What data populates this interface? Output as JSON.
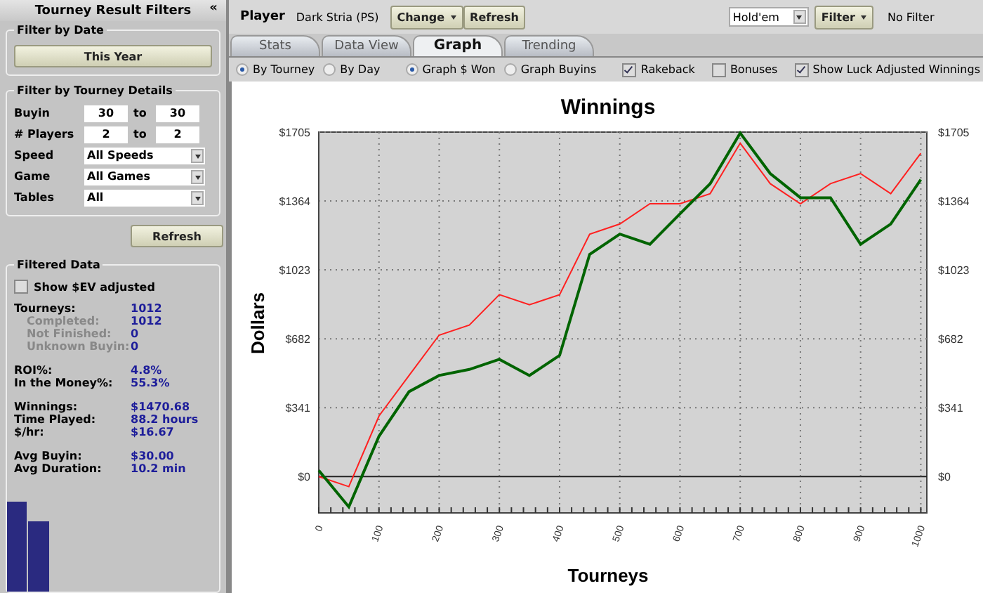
{
  "sidebar": {
    "title": "Tourney Result Filters",
    "collapse": "«",
    "date_filter": {
      "legend": "Filter by Date",
      "button": "This Year"
    },
    "details_filter": {
      "legend": "Filter by Tourney Details",
      "ranges": [
        {
          "label": "Buyin",
          "from": "30",
          "to_label": "to",
          "to": "30"
        },
        {
          "label": "# Players",
          "from": "2",
          "to_label": "to",
          "to": "2"
        }
      ],
      "selects": [
        {
          "label": "Speed",
          "value": "All Speeds"
        },
        {
          "label": "Game",
          "value": "All Games"
        },
        {
          "label": "Tables",
          "value": "All"
        }
      ]
    },
    "refresh": "Refresh",
    "filtered": {
      "legend": "Filtered Data",
      "ev_checkbox": {
        "label": "Show $EV adjusted",
        "checked": false
      },
      "groups": [
        [
          {
            "label": "Tourneys:",
            "value": "1012",
            "kind": "main"
          },
          {
            "label": "Completed:",
            "value": "1012",
            "kind": "sub"
          },
          {
            "label": "Not Finished:",
            "value": "0",
            "kind": "sub"
          },
          {
            "label": "Unknown Buyin:",
            "value": "0",
            "kind": "sub"
          }
        ],
        [
          {
            "label": "ROI%:",
            "value": "4.8%",
            "kind": "main"
          },
          {
            "label": "In the Money%:",
            "value": "55.3%",
            "kind": "main"
          }
        ],
        [
          {
            "label": "Winnings:",
            "value": "$1470.68",
            "kind": "main"
          },
          {
            "label": "Time Played:",
            "value": "88.2 hours",
            "kind": "main"
          },
          {
            "label": "$/hr:",
            "value": "$16.67",
            "kind": "main"
          }
        ],
        [
          {
            "label": "Avg Buyin:",
            "value": "$30.00",
            "kind": "main"
          },
          {
            "label": "Avg Duration:",
            "value": "10.2 min",
            "kind": "main"
          }
        ]
      ]
    }
  },
  "toolbar": {
    "player_label": "Player",
    "player": "Dark Stria (PS)",
    "change": "Change",
    "refresh": "Refresh",
    "game": "Hold'em",
    "filter": "Filter",
    "filter_status": "No Filter"
  },
  "tabs": [
    {
      "label": "Stats",
      "selected": false
    },
    {
      "label": "Data View",
      "selected": false
    },
    {
      "label": "Graph",
      "selected": true
    },
    {
      "label": "Trending",
      "selected": false
    }
  ],
  "options": {
    "radio_groups": [
      [
        {
          "label": "By Tourney",
          "selected": true
        },
        {
          "label": "By Day",
          "selected": false
        }
      ],
      [
        {
          "label": "Graph $ Won",
          "selected": true
        },
        {
          "label": "Graph Buyins",
          "selected": false
        }
      ]
    ],
    "checkboxes": [
      {
        "label": "Rakeback",
        "checked": true
      },
      {
        "label": "Bonuses",
        "checked": false
      },
      {
        "label": "Show Luck Adjusted Winnings",
        "checked": true
      }
    ]
  },
  "graph": {
    "chart_data": {
      "type": "line",
      "title": "Winnings",
      "xlabel": "Tourneys",
      "ylabel": "Dollars",
      "x": [
        0,
        50,
        100,
        150,
        200,
        250,
        300,
        350,
        400,
        450,
        500,
        550,
        600,
        650,
        700,
        750,
        800,
        850,
        900,
        950,
        1000
      ],
      "series": [
        {
          "color": "#006400",
          "values": [
            30,
            -150,
            200,
            420,
            500,
            530,
            580,
            500,
            600,
            1100,
            1200,
            1150,
            1300,
            1450,
            1700,
            1500,
            1380,
            1380,
            1150,
            1250,
            1470
          ]
        },
        {
          "color": "#ff2020",
          "values": [
            0,
            -50,
            300,
            500,
            700,
            750,
            900,
            850,
            900,
            1200,
            1250,
            1350,
            1350,
            1400,
            1650,
            1450,
            1350,
            1450,
            1500,
            1400,
            1600
          ]
        }
      ],
      "grid": true,
      "xlim": [
        0,
        1010
      ],
      "ylim": [
        -180,
        1705
      ],
      "xticks": [
        0,
        100,
        200,
        300,
        400,
        500,
        600,
        700,
        800,
        900,
        1000
      ],
      "yticks": [
        {
          "value": 0,
          "label": "$0"
        },
        {
          "value": 341,
          "label": "$341"
        },
        {
          "value": 682,
          "label": "$682"
        },
        {
          "value": 1023,
          "label": "$1023"
        },
        {
          "value": 1364,
          "label": "$1364"
        },
        {
          "value": 1705,
          "label": "$1705"
        }
      ]
    }
  }
}
